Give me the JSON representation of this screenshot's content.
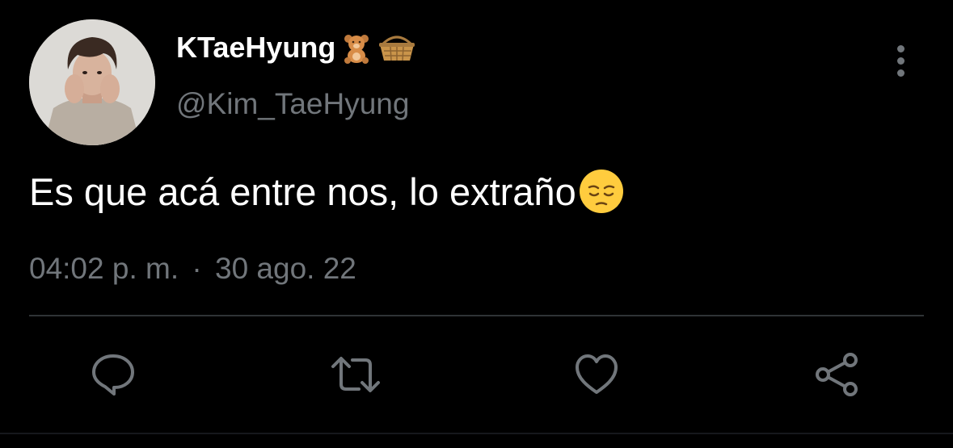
{
  "tweet": {
    "display_name": "KTaeHyung",
    "name_emojis": [
      "teddy-bear-emoji",
      "basket-emoji"
    ],
    "handle": "@Kim_TaeHyung",
    "text": "Es que acá entre nos, lo extraño",
    "text_emoji": "pensive-face-emoji",
    "time": "04:02 p. m.",
    "separator": "·",
    "date": "30 ago. 22"
  },
  "actions": [
    "reply-icon",
    "retweet-icon",
    "like-icon",
    "share-icon"
  ],
  "colors": {
    "background": "#000000",
    "primary_text": "#ffffff",
    "secondary_text": "#71767b",
    "divider": "#2f3336"
  }
}
